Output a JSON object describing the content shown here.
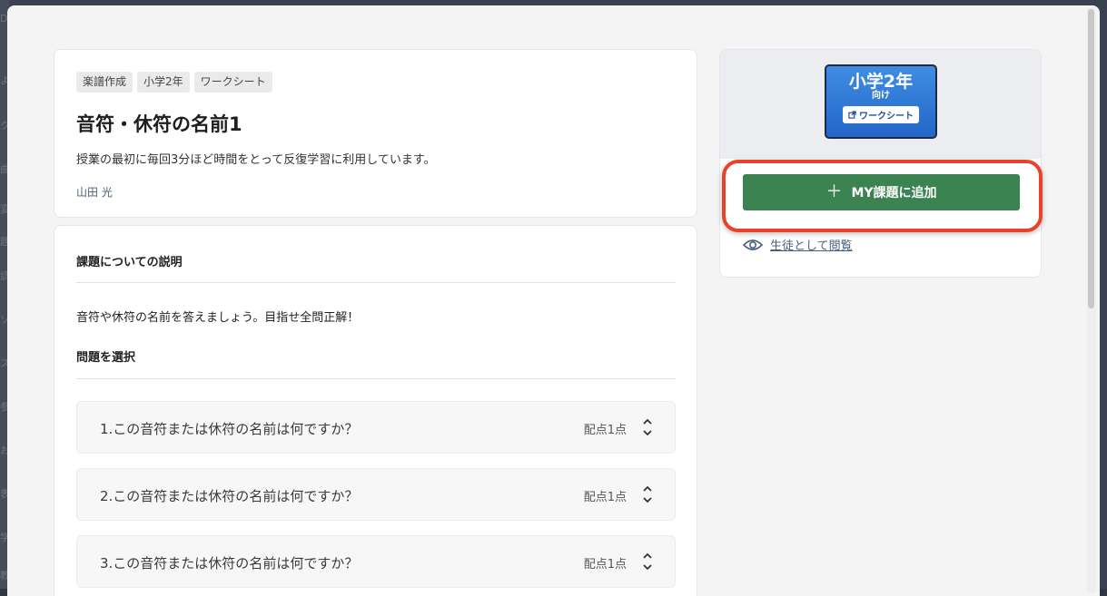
{
  "backdrop": {
    "left_chars": [
      "D",
      "よ",
      "ク",
      "曲",
      "変",
      "題",
      "調",
      "ソ",
      "ス",
      "参",
      "お",
      "表",
      "学",
      "教"
    ]
  },
  "header": {
    "tags": [
      "楽譜作成",
      "小学2年",
      "ワークシート"
    ],
    "title": "音符・休符の名前1",
    "description": "授業の最初に毎回3分ほど時間をとって反復学習に利用しています。",
    "author": "山田 光"
  },
  "body": {
    "explanation_heading": "課題についての説明",
    "explanation_text": "音符や休符の名前を答えましょう。目指せ全問正解！",
    "questions_heading": "問題を選択",
    "questions": [
      {
        "label": "1.この音符または休符の名前は何ですか？",
        "score": "配点1点"
      },
      {
        "label": "2.この音符または休符の名前は何ですか？",
        "score": "配点1点"
      },
      {
        "label": "3.この音符または休符の名前は何ですか？",
        "score": "配点1点"
      }
    ]
  },
  "sidebar": {
    "thumbnail": {
      "grade": "小学2年",
      "for": "向け",
      "chip": "ワークシート"
    },
    "add_button": "MY課題に追加",
    "view_as_student": "生徒として閲覧"
  },
  "colors": {
    "primary_green": "#3b8350",
    "highlight_red": "#e8432a",
    "thumbnail_blue": "#2f7ad6",
    "link": "#4a5f7c"
  }
}
